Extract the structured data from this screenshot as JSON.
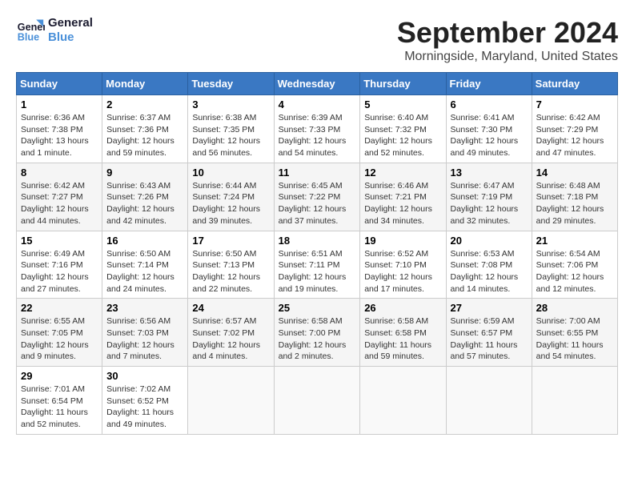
{
  "logo": {
    "line1": "General",
    "line2": "Blue"
  },
  "title": "September 2024",
  "location": "Morningside, Maryland, United States",
  "headers": [
    "Sunday",
    "Monday",
    "Tuesday",
    "Wednesday",
    "Thursday",
    "Friday",
    "Saturday"
  ],
  "weeks": [
    [
      {
        "day": "1",
        "info": "Sunrise: 6:36 AM\nSunset: 7:38 PM\nDaylight: 13 hours\nand 1 minute."
      },
      {
        "day": "2",
        "info": "Sunrise: 6:37 AM\nSunset: 7:36 PM\nDaylight: 12 hours\nand 59 minutes."
      },
      {
        "day": "3",
        "info": "Sunrise: 6:38 AM\nSunset: 7:35 PM\nDaylight: 12 hours\nand 56 minutes."
      },
      {
        "day": "4",
        "info": "Sunrise: 6:39 AM\nSunset: 7:33 PM\nDaylight: 12 hours\nand 54 minutes."
      },
      {
        "day": "5",
        "info": "Sunrise: 6:40 AM\nSunset: 7:32 PM\nDaylight: 12 hours\nand 52 minutes."
      },
      {
        "day": "6",
        "info": "Sunrise: 6:41 AM\nSunset: 7:30 PM\nDaylight: 12 hours\nand 49 minutes."
      },
      {
        "day": "7",
        "info": "Sunrise: 6:42 AM\nSunset: 7:29 PM\nDaylight: 12 hours\nand 47 minutes."
      }
    ],
    [
      {
        "day": "8",
        "info": "Sunrise: 6:42 AM\nSunset: 7:27 PM\nDaylight: 12 hours\nand 44 minutes."
      },
      {
        "day": "9",
        "info": "Sunrise: 6:43 AM\nSunset: 7:26 PM\nDaylight: 12 hours\nand 42 minutes."
      },
      {
        "day": "10",
        "info": "Sunrise: 6:44 AM\nSunset: 7:24 PM\nDaylight: 12 hours\nand 39 minutes."
      },
      {
        "day": "11",
        "info": "Sunrise: 6:45 AM\nSunset: 7:22 PM\nDaylight: 12 hours\nand 37 minutes."
      },
      {
        "day": "12",
        "info": "Sunrise: 6:46 AM\nSunset: 7:21 PM\nDaylight: 12 hours\nand 34 minutes."
      },
      {
        "day": "13",
        "info": "Sunrise: 6:47 AM\nSunset: 7:19 PM\nDaylight: 12 hours\nand 32 minutes."
      },
      {
        "day": "14",
        "info": "Sunrise: 6:48 AM\nSunset: 7:18 PM\nDaylight: 12 hours\nand 29 minutes."
      }
    ],
    [
      {
        "day": "15",
        "info": "Sunrise: 6:49 AM\nSunset: 7:16 PM\nDaylight: 12 hours\nand 27 minutes."
      },
      {
        "day": "16",
        "info": "Sunrise: 6:50 AM\nSunset: 7:14 PM\nDaylight: 12 hours\nand 24 minutes."
      },
      {
        "day": "17",
        "info": "Sunrise: 6:50 AM\nSunset: 7:13 PM\nDaylight: 12 hours\nand 22 minutes."
      },
      {
        "day": "18",
        "info": "Sunrise: 6:51 AM\nSunset: 7:11 PM\nDaylight: 12 hours\nand 19 minutes."
      },
      {
        "day": "19",
        "info": "Sunrise: 6:52 AM\nSunset: 7:10 PM\nDaylight: 12 hours\nand 17 minutes."
      },
      {
        "day": "20",
        "info": "Sunrise: 6:53 AM\nSunset: 7:08 PM\nDaylight: 12 hours\nand 14 minutes."
      },
      {
        "day": "21",
        "info": "Sunrise: 6:54 AM\nSunset: 7:06 PM\nDaylight: 12 hours\nand 12 minutes."
      }
    ],
    [
      {
        "day": "22",
        "info": "Sunrise: 6:55 AM\nSunset: 7:05 PM\nDaylight: 12 hours\nand 9 minutes."
      },
      {
        "day": "23",
        "info": "Sunrise: 6:56 AM\nSunset: 7:03 PM\nDaylight: 12 hours\nand 7 minutes."
      },
      {
        "day": "24",
        "info": "Sunrise: 6:57 AM\nSunset: 7:02 PM\nDaylight: 12 hours\nand 4 minutes."
      },
      {
        "day": "25",
        "info": "Sunrise: 6:58 AM\nSunset: 7:00 PM\nDaylight: 12 hours\nand 2 minutes."
      },
      {
        "day": "26",
        "info": "Sunrise: 6:58 AM\nSunset: 6:58 PM\nDaylight: 11 hours\nand 59 minutes."
      },
      {
        "day": "27",
        "info": "Sunrise: 6:59 AM\nSunset: 6:57 PM\nDaylight: 11 hours\nand 57 minutes."
      },
      {
        "day": "28",
        "info": "Sunrise: 7:00 AM\nSunset: 6:55 PM\nDaylight: 11 hours\nand 54 minutes."
      }
    ],
    [
      {
        "day": "29",
        "info": "Sunrise: 7:01 AM\nSunset: 6:54 PM\nDaylight: 11 hours\nand 52 minutes."
      },
      {
        "day": "30",
        "info": "Sunrise: 7:02 AM\nSunset: 6:52 PM\nDaylight: 11 hours\nand 49 minutes."
      },
      null,
      null,
      null,
      null,
      null
    ]
  ]
}
